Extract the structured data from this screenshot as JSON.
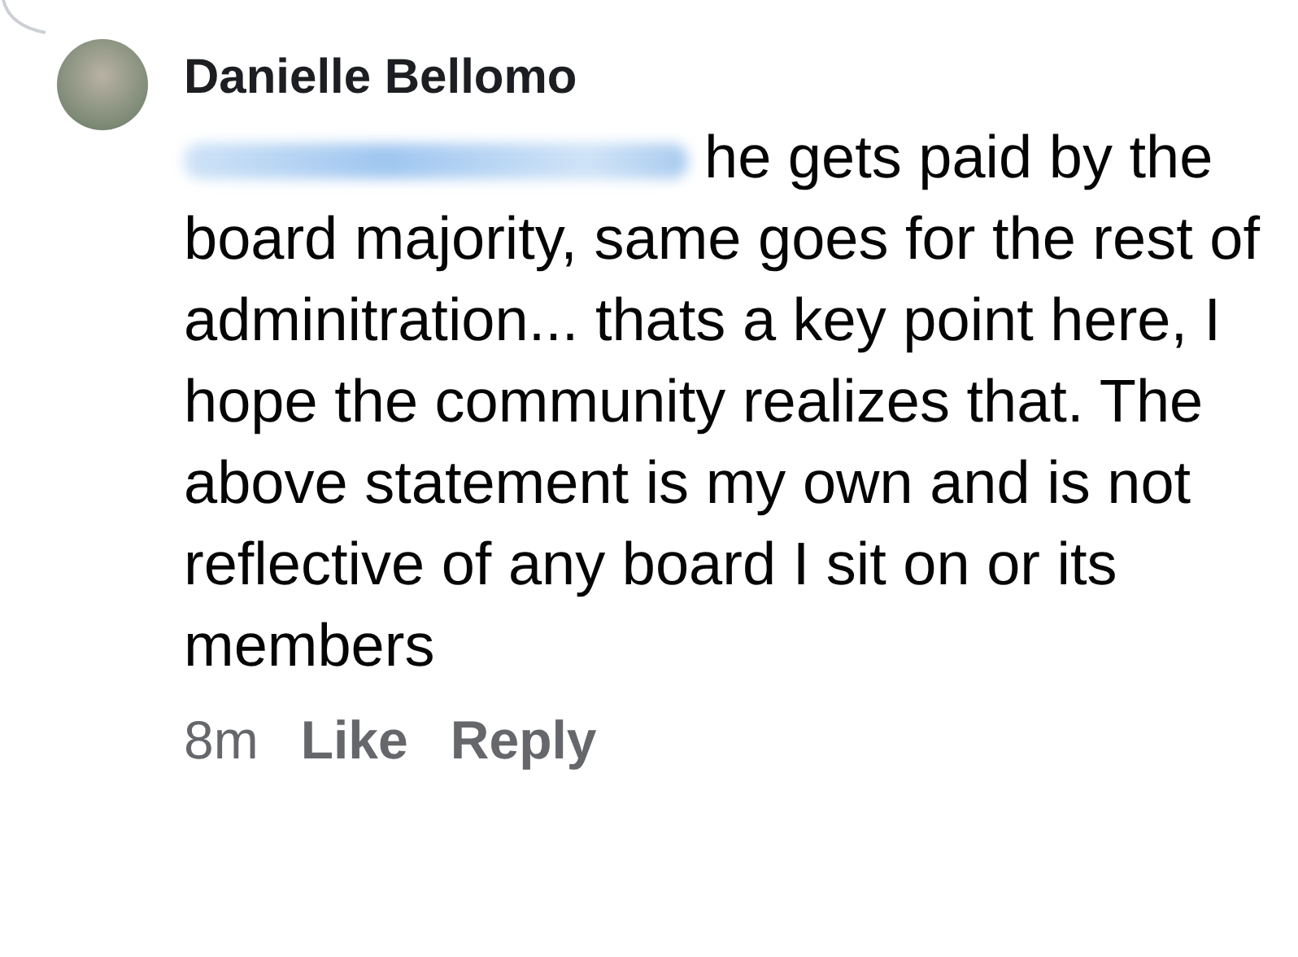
{
  "comment": {
    "author": "Danielle Bellomo",
    "mention_redacted": true,
    "text": "he gets paid by the board majority, same goes for the rest of adminitration... thats a key point here, I hope the community realizes that. The above statement is my own and is not reflective of any board I sit on or its members",
    "time": "8m",
    "actions": [
      "Like",
      "Reply"
    ]
  }
}
